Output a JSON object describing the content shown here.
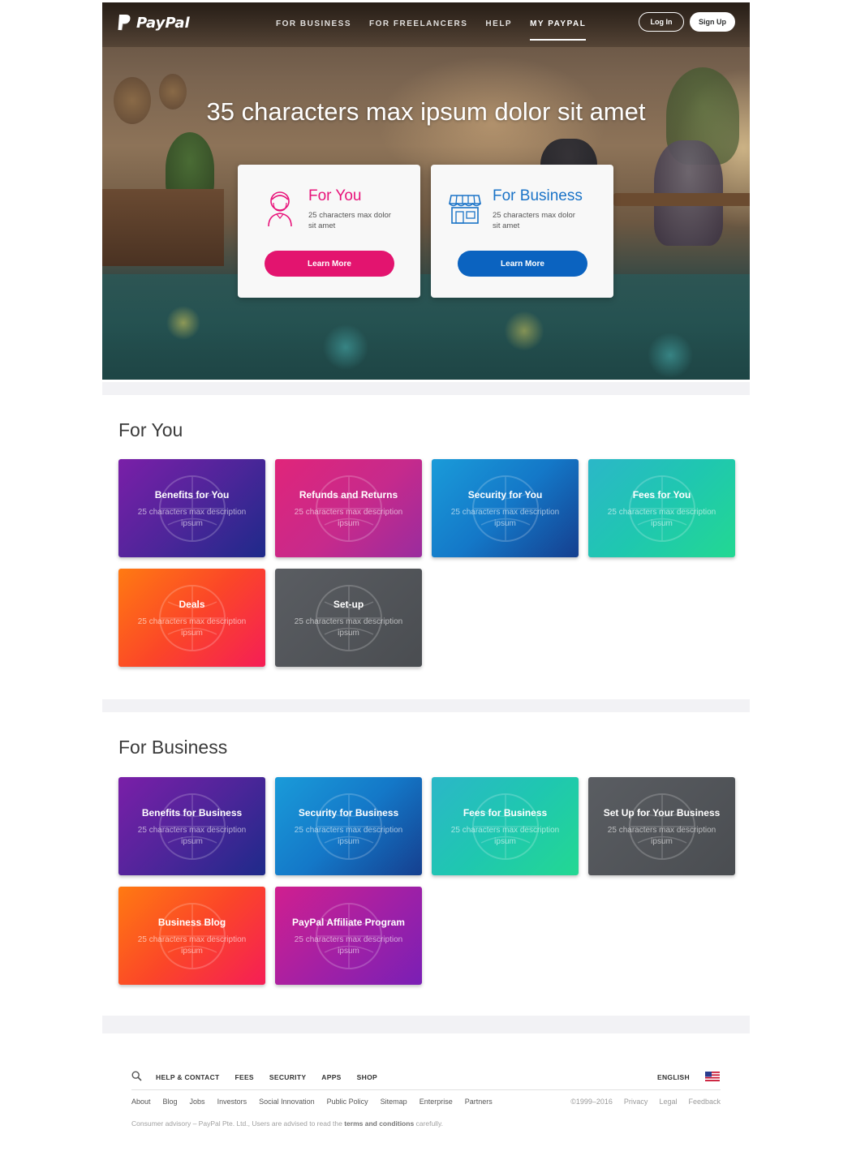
{
  "brand": {
    "name": "PayPal",
    "colors": {
      "pink": "#e3146f",
      "blue": "#0b63c0",
      "dark": "#2c2e2f"
    }
  },
  "nav": {
    "links": [
      {
        "label": "FOR BUSINESS",
        "active": false
      },
      {
        "label": "FOR FREELANCERS",
        "active": false
      },
      {
        "label": "HELP",
        "active": false
      },
      {
        "label": "MY PAYPAL",
        "active": true
      }
    ],
    "login_label": "Log In",
    "signup_label": "Sign Up"
  },
  "hero": {
    "title": "35 characters max ipsum dolor sit amet",
    "cards": [
      {
        "icon": "person-icon",
        "title": "For You",
        "desc": "25 characters max dolor sit amet",
        "button": "Learn More",
        "color": "#e3146f"
      },
      {
        "icon": "storefront-icon",
        "title": "For Business",
        "desc": "25 characters max dolor sit amet",
        "button": "Learn More",
        "color": "#0b63c0"
      }
    ]
  },
  "for_you": {
    "title": "For You",
    "tiles": [
      {
        "title": "Benefits for You",
        "desc": "25 characters max description ipsum",
        "gradient": "purple"
      },
      {
        "title": "Refunds and Returns",
        "desc": "25 characters max description ipsum",
        "gradient": "pink"
      },
      {
        "title": "Security for You",
        "desc": "25 characters max description ipsum",
        "gradient": "blue"
      },
      {
        "title": "Fees for You",
        "desc": "25 characters max description ipsum",
        "gradient": "teal"
      },
      {
        "title": "Deals",
        "desc": "25 characters max description ipsum",
        "gradient": "orange"
      },
      {
        "title": "Set-up",
        "desc": "25 characters max description ipsum",
        "gradient": "gray"
      }
    ]
  },
  "for_business": {
    "title": "For Business",
    "tiles": [
      {
        "title": "Benefits for Business",
        "desc": "25 characters max description ipsum",
        "gradient": "purple"
      },
      {
        "title": "Security for Business",
        "desc": "25 characters max description ipsum",
        "gradient": "blue"
      },
      {
        "title": "Fees for Business",
        "desc": "25 characters max description ipsum",
        "gradient": "teal"
      },
      {
        "title": "Set Up for Your Business",
        "desc": "25 characters max description ipsum",
        "gradient": "gray"
      },
      {
        "title": "Business Blog",
        "desc": "25 characters max description ipsum",
        "gradient": "orange"
      },
      {
        "title": "PayPal Affiliate Program",
        "desc": "25 characters max description ipsum",
        "gradient": "magenta"
      }
    ]
  },
  "footer": {
    "nav": [
      "HELP & CONTACT",
      "FEES",
      "SECURITY",
      "APPS",
      "SHOP"
    ],
    "language": "ENGLISH",
    "flag_icon": "us-flag-icon",
    "links": [
      "About",
      "Blog",
      "Jobs",
      "Investors",
      "Social Innovation",
      "Public Policy",
      "Sitemap",
      "Enterprise",
      "Partners"
    ],
    "copyright": "©1999–2016",
    "legal": [
      "Privacy",
      "Legal",
      "Feedback"
    ],
    "advisory_prefix": "Consumer advisory – PayPal Pte. Ltd., Users are advised to read the ",
    "advisory_bold": "terms and conditions",
    "advisory_suffix": " carefully."
  }
}
